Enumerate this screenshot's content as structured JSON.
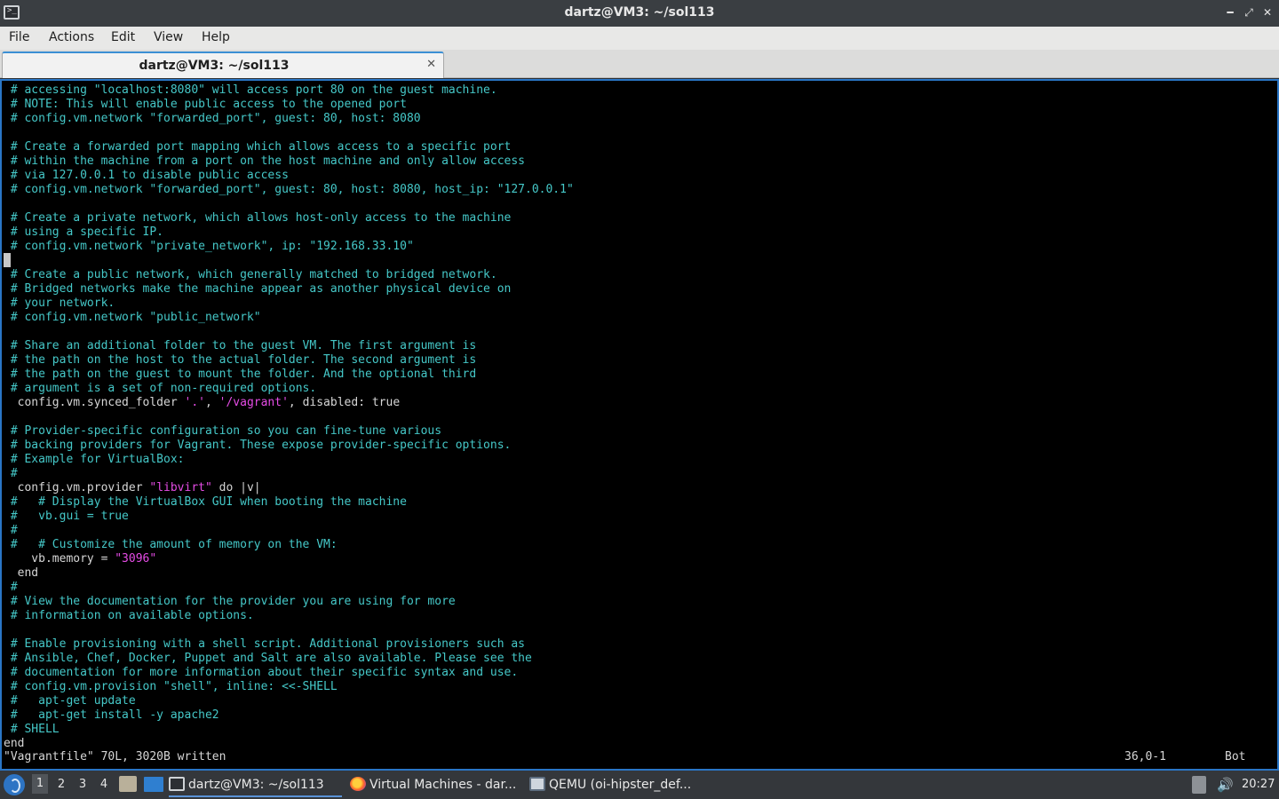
{
  "window": {
    "title": "dartz@VM3: ~/sol113",
    "minimize": "━",
    "maximize": "⤢",
    "close": "✕"
  },
  "menu": [
    "File",
    "Actions",
    "Edit",
    "View",
    "Help"
  ],
  "tab": {
    "label": "dartz@VM3: ~/sol113",
    "close": "✕"
  },
  "terminal": {
    "lines": [
      {
        "parts": [
          {
            "t": " # accessing \"localhost:8080\" will access port 80 on the guest machine."
          }
        ],
        "comment": true
      },
      {
        "parts": [
          {
            "t": " # NOTE: This will enable public access to the opened port"
          }
        ],
        "comment": true
      },
      {
        "parts": [
          {
            "t": " # config.vm.network \"forwarded_port\", guest: 80, host: 8080"
          }
        ],
        "comment": true
      },
      {
        "parts": [
          {
            "t": ""
          }
        ],
        "comment": true
      },
      {
        "parts": [
          {
            "t": " # Create a forwarded port mapping which allows access to a specific port"
          }
        ],
        "comment": true
      },
      {
        "parts": [
          {
            "t": " # within the machine from a port on the host machine and only allow access"
          }
        ],
        "comment": true
      },
      {
        "parts": [
          {
            "t": " # via 127.0.0.1 to disable public access"
          }
        ],
        "comment": true
      },
      {
        "parts": [
          {
            "t": " # config.vm.network \"forwarded_port\", guest: 80, host: 8080, host_ip: \"127.0.0.1\""
          }
        ],
        "comment": true
      },
      {
        "parts": [
          {
            "t": ""
          }
        ],
        "comment": true
      },
      {
        "parts": [
          {
            "t": " # Create a private network, which allows host-only access to the machine"
          }
        ],
        "comment": true
      },
      {
        "parts": [
          {
            "t": " # using a specific IP."
          }
        ],
        "comment": true
      },
      {
        "parts": [
          {
            "t": " # config.vm.network \"private_network\", ip: \"192.168.33.10\""
          }
        ],
        "comment": true
      },
      {
        "parts": [
          {
            "t": ""
          }
        ],
        "comment": true
      },
      {
        "parts": [
          {
            "t": " # Create a public network, which generally matched to bridged network."
          }
        ],
        "comment": true
      },
      {
        "parts": [
          {
            "t": " # Bridged networks make the machine appear as another physical device on"
          }
        ],
        "comment": true
      },
      {
        "parts": [
          {
            "t": " # your network."
          }
        ],
        "comment": true
      },
      {
        "parts": [
          {
            "t": " # config.vm.network \"public_network\""
          }
        ],
        "comment": true
      },
      {
        "parts": [
          {
            "t": ""
          }
        ],
        "comment": true
      },
      {
        "parts": [
          {
            "t": " # Share an additional folder to the guest VM. The first argument is"
          }
        ],
        "comment": true
      },
      {
        "parts": [
          {
            "t": " # the path on the host to the actual folder. The second argument is"
          }
        ],
        "comment": true
      },
      {
        "parts": [
          {
            "t": " # the path on the guest to mount the folder. And the optional third"
          }
        ],
        "comment": true
      },
      {
        "parts": [
          {
            "t": " # argument is a set of non-required options."
          }
        ],
        "comment": true
      },
      {
        "parts": [
          {
            "t": "  config.vm.synced_folder "
          },
          {
            "t": "'.'",
            "s": 1
          },
          {
            "t": ", "
          },
          {
            "t": "'/vagrant'",
            "s": 1
          },
          {
            "t": ", disabled: true"
          }
        ],
        "comment": false
      },
      {
        "parts": [
          {
            "t": ""
          }
        ],
        "comment": true
      },
      {
        "parts": [
          {
            "t": " # Provider-specific configuration so you can fine-tune various"
          }
        ],
        "comment": true
      },
      {
        "parts": [
          {
            "t": " # backing providers for Vagrant. These expose provider-specific options."
          }
        ],
        "comment": true
      },
      {
        "parts": [
          {
            "t": " # Example for VirtualBox:"
          }
        ],
        "comment": true
      },
      {
        "parts": [
          {
            "t": " #"
          }
        ],
        "comment": true
      },
      {
        "parts": [
          {
            "t": "  config.vm.provider "
          },
          {
            "t": "\"libvirt\"",
            "s": 1
          },
          {
            "t": " do |v|"
          }
        ],
        "comment": false
      },
      {
        "parts": [
          {
            "t": " #   # Display the VirtualBox GUI when booting the machine"
          }
        ],
        "comment": true
      },
      {
        "parts": [
          {
            "t": " #   vb.gui = true"
          }
        ],
        "comment": true
      },
      {
        "parts": [
          {
            "t": " #"
          }
        ],
        "comment": true
      },
      {
        "parts": [
          {
            "t": " #   # Customize the amount of memory on the VM:"
          }
        ],
        "comment": true
      },
      {
        "parts": [
          {
            "t": "    vb.memory = "
          },
          {
            "t": "\"3096\"",
            "s": 1
          }
        ],
        "comment": false
      },
      {
        "parts": [
          {
            "t": "  end"
          }
        ],
        "comment": false
      },
      {
        "parts": [
          {
            "t": " #"
          }
        ],
        "comment": true
      },
      {
        "parts": [
          {
            "t": " # View the documentation for the provider you are using for more"
          }
        ],
        "comment": true
      },
      {
        "parts": [
          {
            "t": " # information on available options."
          }
        ],
        "comment": true
      },
      {
        "parts": [
          {
            "t": ""
          }
        ],
        "comment": true
      },
      {
        "parts": [
          {
            "t": " # Enable provisioning with a shell script. Additional provisioners such as"
          }
        ],
        "comment": true
      },
      {
        "parts": [
          {
            "t": " # Ansible, Chef, Docker, Puppet and Salt are also available. Please see the"
          }
        ],
        "comment": true
      },
      {
        "parts": [
          {
            "t": " # documentation for more information about their specific syntax and use."
          }
        ],
        "comment": true
      },
      {
        "parts": [
          {
            "t": " # config.vm.provision \"shell\", inline: <<-SHELL"
          }
        ],
        "comment": true
      },
      {
        "parts": [
          {
            "t": " #   apt-get update"
          }
        ],
        "comment": true
      },
      {
        "parts": [
          {
            "t": " #   apt-get install -y apache2"
          }
        ],
        "comment": true
      },
      {
        "parts": [
          {
            "t": " # SHELL"
          }
        ],
        "comment": true
      },
      {
        "parts": [
          {
            "t": "end"
          }
        ],
        "comment": false
      }
    ],
    "status_message": "\"Vagrantfile\" 70L, 3020B written",
    "cursor_position": "36,0-1",
    "scroll_position": "Bot"
  },
  "taskbar": {
    "workspaces": [
      "1",
      "2",
      "3",
      "4"
    ],
    "tasks": [
      {
        "label": "dartz@VM3: ~/sol113",
        "icon": "terminal-icon",
        "active": true
      },
      {
        "label": "Virtual Machines - dar...",
        "icon": "firefox-icon",
        "active": false
      },
      {
        "label": "QEMU (oi-hipster_def...",
        "icon": "qemu-icon",
        "active": false
      }
    ],
    "volume_icon": "🔊",
    "clock": "20:27"
  }
}
